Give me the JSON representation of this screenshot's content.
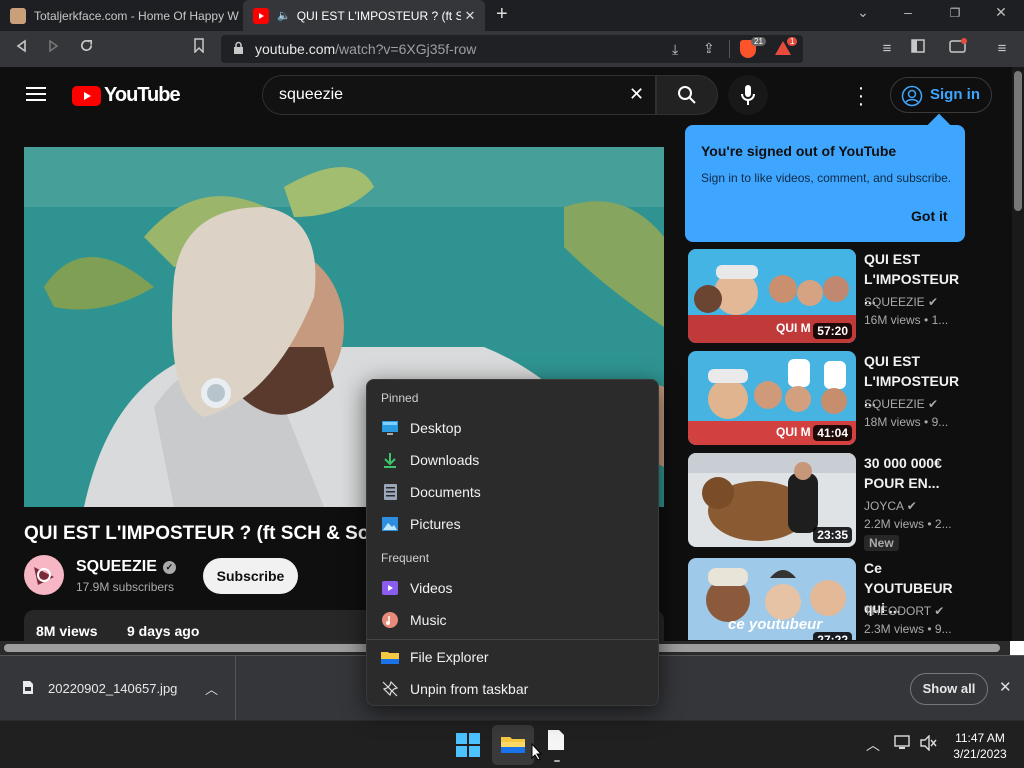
{
  "browser": {
    "tabs": [
      {
        "title": "Totaljerkface.com - Home Of Happy W",
        "active": false
      },
      {
        "title": "QUI EST L'IMPOSTEUR ? (ft SCH",
        "active": true
      }
    ],
    "new_tab": "+",
    "url_host": "youtube.com",
    "url_path": "/watch?v=6XGj35f-row",
    "brave_badge": "21",
    "rewards_badge": "1"
  },
  "youtube": {
    "logo_text": "YouTube",
    "search_value": "squeezie",
    "signin_label": "Sign in",
    "popup": {
      "title": "You're signed out of YouTube",
      "body": "Sign in to like videos, comment, and subscribe.",
      "button": "Got it"
    },
    "video": {
      "title": "QUI EST L'IMPOSTEUR ? (ft SCH & Soso",
      "channel": "SQUEEZIE",
      "subscribers": "17.9M subscribers",
      "subscribe_label": "Subscribe",
      "views": "8M views",
      "age": "9 days ago"
    },
    "recommendations": [
      {
        "title": "QUI EST L'IMPOSTEUR ...",
        "channel": "SQUEEZIE",
        "views": "16M views",
        "age": "• 1...",
        "duration": "57:20",
        "thumb_label": "QUI M",
        "badge": ""
      },
      {
        "title": "QUI EST L'IMPOSTEUR ...",
        "channel": "SQUEEZIE",
        "views": "18M views",
        "age": "• 9...",
        "duration": "41:04",
        "thumb_label": "QUI M",
        "badge": ""
      },
      {
        "title": "30 000 000€ POUR EN...",
        "channel": "JOYCA",
        "views": "2.2M views",
        "age": "• 2...",
        "duration": "23:35",
        "thumb_label": "",
        "badge": "New"
      },
      {
        "title": "Ce YOUTUBEUR qui ...",
        "channel": "THEODORT",
        "views": "2.3M views",
        "age": "• 9...",
        "duration": "27:22",
        "thumb_label": "ce youtubeur",
        "badge": ""
      }
    ]
  },
  "jumplist": {
    "pinned_header": "Pinned",
    "pinned": [
      {
        "label": "Desktop",
        "icon": "desktop-icon"
      },
      {
        "label": "Downloads",
        "icon": "downloads-icon"
      },
      {
        "label": "Documents",
        "icon": "documents-icon"
      },
      {
        "label": "Pictures",
        "icon": "pictures-icon"
      }
    ],
    "frequent_header": "Frequent",
    "frequent": [
      {
        "label": "Videos",
        "icon": "videos-icon"
      },
      {
        "label": "Music",
        "icon": "music-icon"
      }
    ],
    "actions": [
      {
        "label": "File Explorer",
        "icon": "folder-icon"
      },
      {
        "label": "Unpin from taskbar",
        "icon": "unpin-icon"
      }
    ]
  },
  "downloads": {
    "file_name": "20220902_140657.jpg",
    "show_all": "Show all"
  },
  "taskbar": {
    "time": "11:47 AM",
    "date": "3/21/2023"
  },
  "colors": {
    "accent_blue": "#3ea6ff",
    "youtube_red": "#ff0000",
    "page_bg": "#0f0f0f"
  }
}
